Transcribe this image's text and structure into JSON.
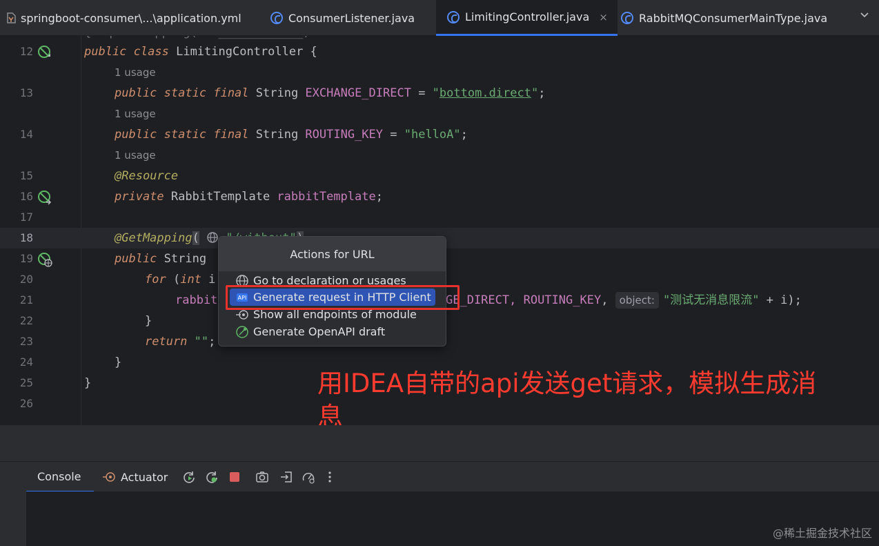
{
  "tabs": [
    {
      "label": "springboot-consumer\\...\\application.yml",
      "icon": "yaml-file-icon",
      "active": false
    },
    {
      "label": "ConsumerListener.java",
      "icon": "class-icon",
      "active": false
    },
    {
      "label": "LimitingController.java",
      "icon": "class-icon",
      "active": true
    },
    {
      "label": "RabbitMQConsumerMainType.java",
      "icon": "class-icon",
      "active": false
    }
  ],
  "tab_close": "×",
  "editor": {
    "usage_label": "1 usage",
    "lines": [
      {
        "num": "12",
        "parts": [
          "public",
          " ",
          "class",
          " LimitingController {"
        ]
      },
      {
        "num": "13",
        "parts": [
          "public",
          " ",
          "static",
          " ",
          "final",
          " String ",
          "EXCHANGE_DIRECT",
          " = ",
          "\"",
          "bottom.direct",
          "\"",
          ";"
        ]
      },
      {
        "num": "14",
        "parts": [
          "public",
          " ",
          "static",
          " ",
          "final",
          " String ",
          "ROUTING_KEY",
          " = ",
          "\"helloA\"",
          ";"
        ]
      },
      {
        "num": "15",
        "parts": [
          "@Resource"
        ]
      },
      {
        "num": "16",
        "parts": [
          "private",
          " RabbitTemplate ",
          "rabbitTemplate",
          ";"
        ]
      },
      {
        "num": "17",
        "parts": [
          ""
        ]
      },
      {
        "num": "18",
        "parts": [
          "@GetMapping",
          "(",
          " ",
          "\"/without\"",
          ")"
        ]
      },
      {
        "num": "19",
        "parts": [
          "public",
          " String"
        ]
      },
      {
        "num": "20",
        "parts": [
          "for",
          " (",
          "int",
          " i"
        ]
      },
      {
        "num": "21",
        "parts": [
          "rabbit",
          "GE_DIRECT, ",
          "ROUTING_KEY",
          ", ",
          "object:",
          "\"测试无消息限流\"",
          " + i);"
        ]
      },
      {
        "num": "22",
        "parts": [
          "}"
        ]
      },
      {
        "num": "23",
        "parts": [
          "return",
          " ",
          "\"\"",
          ";"
        ]
      },
      {
        "num": "24",
        "parts": [
          "}"
        ]
      },
      {
        "num": "25",
        "parts": [
          "}"
        ]
      },
      {
        "num": "26",
        "parts": [
          ""
        ]
      }
    ]
  },
  "popup": {
    "title": "Actions for URL",
    "items": [
      {
        "label": "Go to declaration or usages",
        "icon": "globe-icon",
        "selected": false
      },
      {
        "label": "Generate request in HTTP Client",
        "icon": "http-client-icon",
        "selected": true
      },
      {
        "label": "Show all endpoints of module",
        "icon": "endpoints-icon",
        "selected": false
      },
      {
        "label": "Generate OpenAPI draft",
        "icon": "openapi-icon",
        "selected": false
      }
    ]
  },
  "annotation": "用IDEA自带的api发送get请求，模拟生成消息",
  "tool_window": {
    "tabs": [
      {
        "label": "Console",
        "active": true
      },
      {
        "label": "Actuator",
        "icon": "actuator-icon",
        "active": false
      }
    ],
    "buttons": [
      "rerun-icon",
      "rerun-debug-icon",
      "stop-icon",
      "screenshot-icon",
      "login-icon",
      "dashboard-icon",
      "more-icon"
    ]
  },
  "watermark": "@稀土掘金技术社区",
  "colors": {
    "accent": "#3574f0",
    "selection": "#2e55b3",
    "annotation_red": "#ff3b30",
    "keyword": "#cf8e6d",
    "string": "#6aab73",
    "field": "#c77dbb"
  }
}
